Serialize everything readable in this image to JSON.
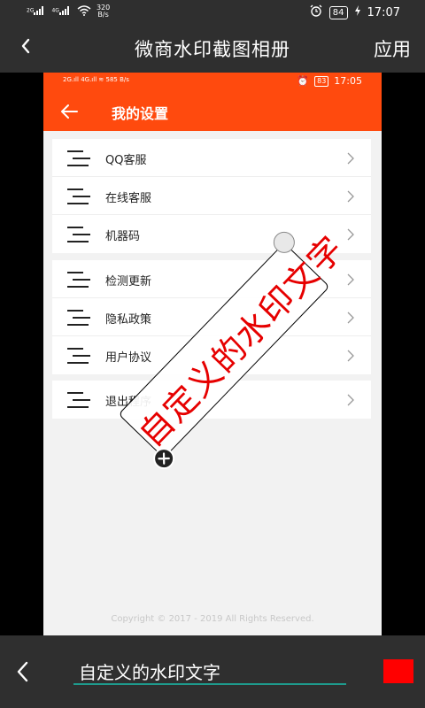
{
  "status_bar": {
    "signal_1": "2G",
    "signal_2": "4G",
    "net_speed_value": "320",
    "net_speed_unit": "B/s",
    "battery": "84",
    "time": "17:07",
    "icons": [
      "signal-icon",
      "wifi-icon",
      "alarm-icon",
      "battery-icon",
      "charging-icon"
    ]
  },
  "app_bar": {
    "title": "微商水印截图相册",
    "apply_label": "应用",
    "back_icon": "chevron-left-icon"
  },
  "inner_screenshot": {
    "status_bar": {
      "signal_1": "2G",
      "signal_2": "4G",
      "net_speed_value": "585",
      "net_speed_unit": "B/s",
      "battery": "83",
      "time": "17:05"
    },
    "header": {
      "title": "我的设置",
      "color": "#ff4a0e"
    },
    "groups": [
      {
        "items": [
          {
            "label": "QQ客服"
          },
          {
            "label": "在线客服"
          },
          {
            "label": "机器码"
          }
        ]
      },
      {
        "items": [
          {
            "label": "检测更新"
          },
          {
            "label": "隐私政策"
          },
          {
            "label": "用户协议"
          }
        ]
      },
      {
        "items": [
          {
            "label": "退出程序"
          }
        ]
      }
    ],
    "copyright": "Copyright © 2017 - 2019 All Rights Reserved."
  },
  "watermark": {
    "text": "自定义的水印文字",
    "color": "#e60000"
  },
  "bottom_bar": {
    "input_value": "自定义的水印文字",
    "accent_color": "#1e9b8d",
    "swatch_color": "#ff0000"
  }
}
